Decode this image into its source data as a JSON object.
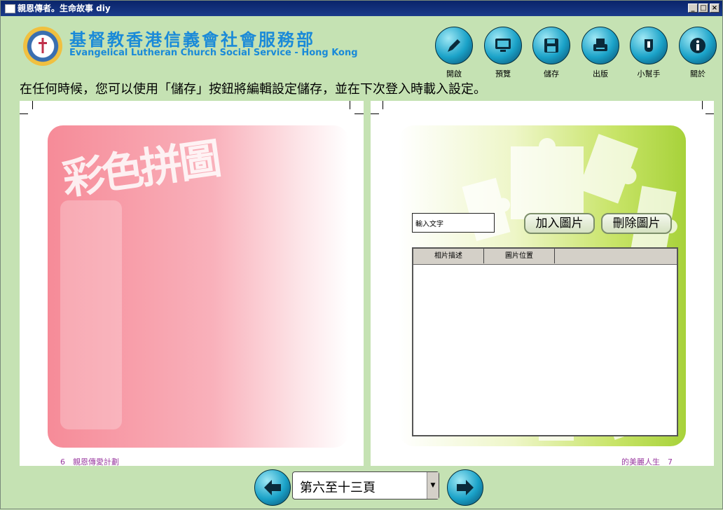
{
  "window": {
    "title": "親恩傳者。生命故事 diy",
    "controls": [
      "_",
      "□",
      "×"
    ]
  },
  "org": {
    "name_cn": "基督教香港信義會社會服務部",
    "name_en": "Evangelical Lutheran Church Social Service - Hong Kong"
  },
  "toolbar": [
    {
      "label": "開啟",
      "icon": "pencil-icon"
    },
    {
      "label": "預覽",
      "icon": "monitor-icon"
    },
    {
      "label": "儲存",
      "icon": "floppy-disk-icon"
    },
    {
      "label": "出版",
      "icon": "printer-icon"
    },
    {
      "label": "小幫手",
      "icon": "helper-icon"
    },
    {
      "label": "關於",
      "icon": "info-icon"
    }
  ],
  "notice": "在任何時候，您可以使用「儲存」按鈕將編輯設定儲存，並在下次登入時載入設定。",
  "left_page": {
    "title": "彩色拼圖",
    "footer": "6　親恩傳愛計劃"
  },
  "right_page": {
    "text_input_value": "輸入文字",
    "add_button": "加入圖片",
    "delete_button": "刪除圖片",
    "columns": [
      "相片描述",
      "圖片位置"
    ],
    "footer": "的美麗人生　7"
  },
  "pager": {
    "selected": "第六至十三頁"
  },
  "colors": {
    "background": "#c5e2b3",
    "accent": "#1a8ad8",
    "footer_text": "#9a3aa0"
  }
}
